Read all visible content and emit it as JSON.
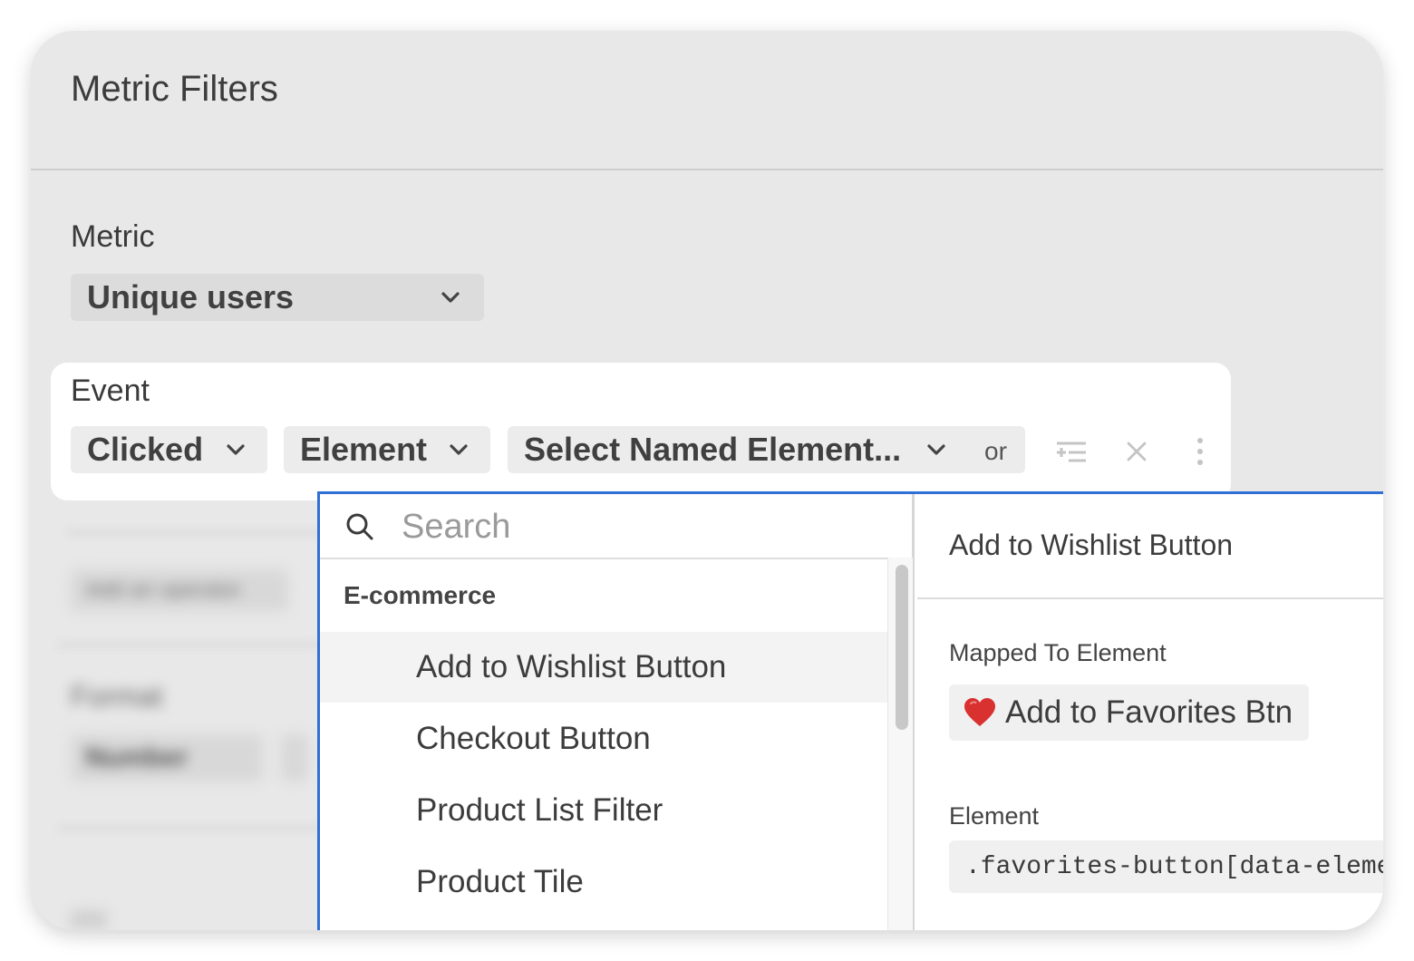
{
  "header": {
    "title": "Metric Filters"
  },
  "metric": {
    "label": "Metric",
    "value": "Unique users"
  },
  "event": {
    "label": "Event",
    "action": "Clicked",
    "type": "Element",
    "target_placeholder": "Select Named Element...",
    "or_label": "or"
  },
  "background": {
    "operator_placeholder": "Add an operator",
    "format_label": "Format",
    "format_value": "Number"
  },
  "dropdown": {
    "search_placeholder": "Search",
    "group": "E-commerce",
    "items": [
      {
        "label": "Add to Wishlist Button",
        "active": true
      },
      {
        "label": "Checkout Button",
        "active": false
      },
      {
        "label": "Product List Filter",
        "active": false
      },
      {
        "label": "Product Tile",
        "active": false
      }
    ]
  },
  "detail": {
    "title": "Add to Wishlist Button",
    "mapped_label": "Mapped To Element",
    "mapped_icon": "heart-emoji",
    "mapped_value": "Add to Favorites Btn",
    "element_label": "Element",
    "element_selector": ".favorites-button[data-element"
  },
  "colors": {
    "accent": "#2f6fd6",
    "card_bg": "#e8e8e8",
    "heart": "#d93030"
  }
}
